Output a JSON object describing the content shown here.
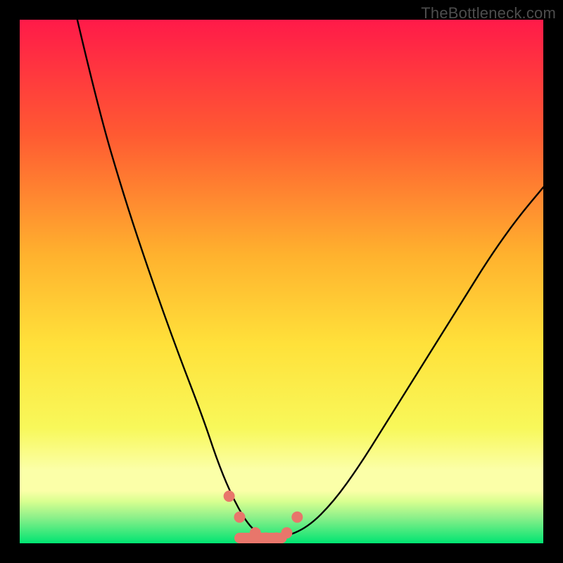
{
  "watermark": "TheBottleneck.com",
  "colors": {
    "frame": "#000000",
    "gradient_top": "#ff1a49",
    "gradient_mid1": "#ff7e2a",
    "gradient_mid2": "#ffd236",
    "gradient_mid3": "#f8f85a",
    "gradient_low_band": "#fbffa8",
    "gradient_bottom": "#00e472",
    "curve": "#000000",
    "marker": "#e8766b"
  },
  "chart_data": {
    "type": "line",
    "title": "",
    "xlabel": "",
    "ylabel": "",
    "xlim": [
      0,
      100
    ],
    "ylim": [
      0,
      100
    ],
    "series": [
      {
        "name": "bottleneck-curve",
        "x": [
          11,
          15,
          20,
          25,
          30,
          35,
          38,
          41,
          44,
          47,
          50,
          55,
          60,
          65,
          70,
          75,
          80,
          85,
          90,
          95,
          100
        ],
        "y": [
          100,
          83,
          66,
          51,
          37,
          24,
          15,
          8,
          3,
          1,
          1,
          3,
          8,
          15,
          23,
          31,
          39,
          47,
          55,
          62,
          68
        ]
      }
    ],
    "markers": {
      "name": "highlight-points",
      "x": [
        40,
        42,
        45,
        47,
        49,
        51,
        53
      ],
      "y": [
        9,
        5,
        2,
        1,
        1,
        2,
        5
      ]
    },
    "minimum_plateau": {
      "x_range": [
        42,
        50
      ],
      "y": 1
    }
  }
}
